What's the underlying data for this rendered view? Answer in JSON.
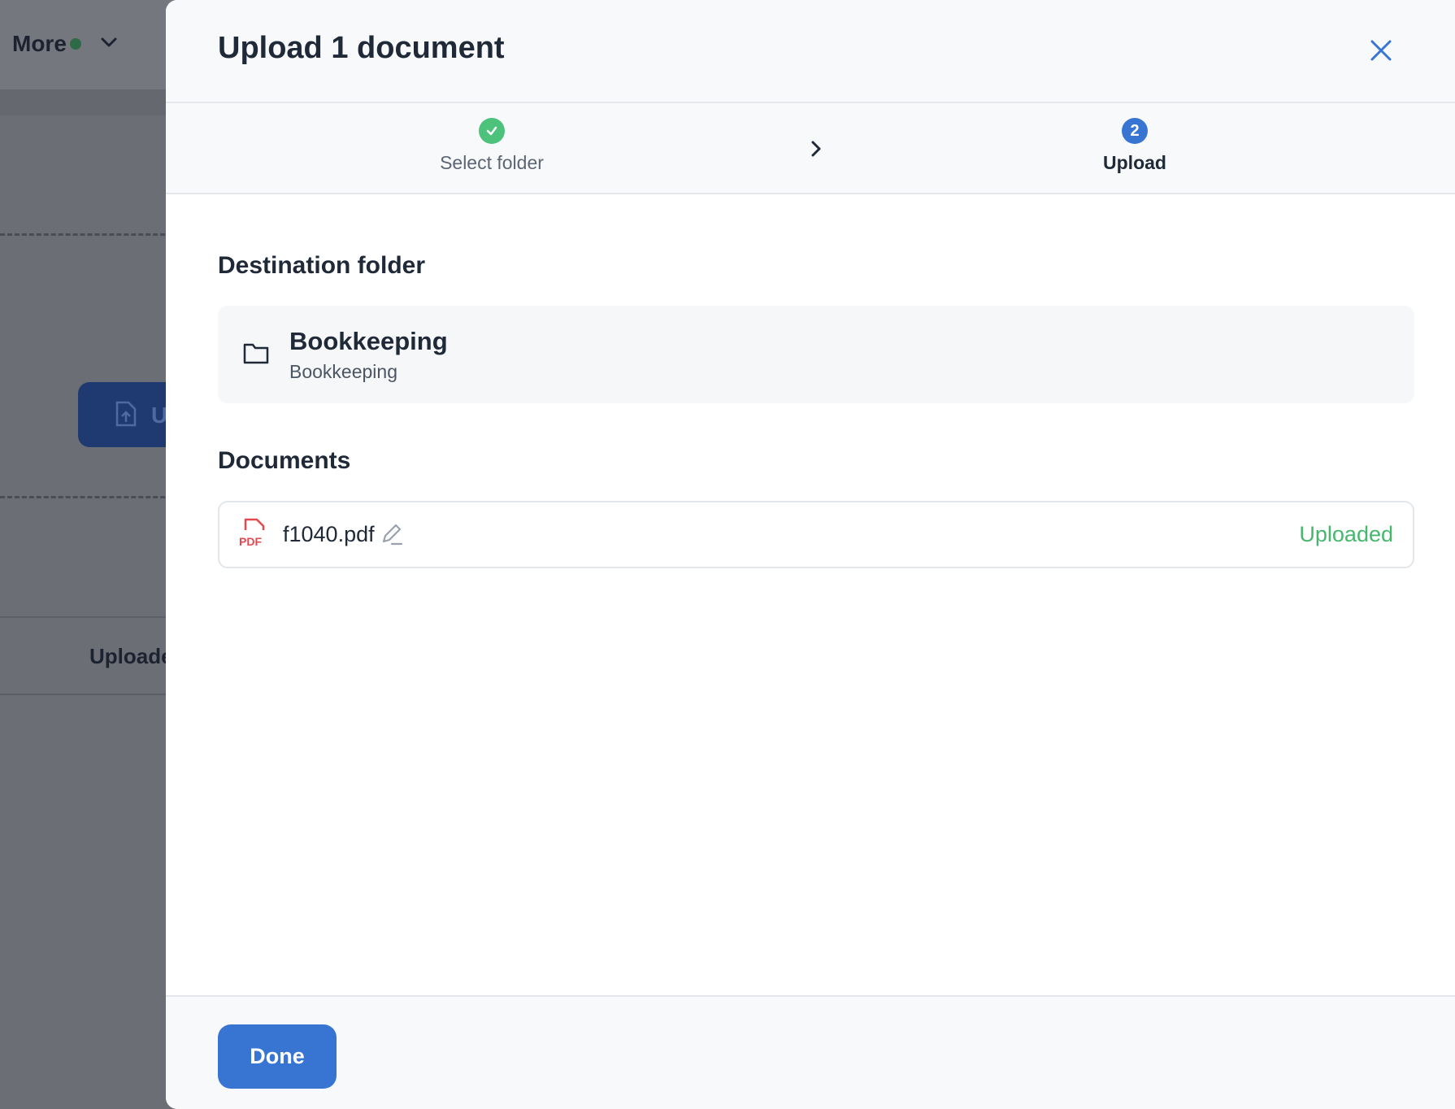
{
  "background": {
    "more_label": "More",
    "upload_button_partial": "U",
    "column_header_partial": "Uploade"
  },
  "modal": {
    "title": "Upload 1 document",
    "steps": [
      {
        "label": "Select folder",
        "state": "done"
      },
      {
        "label": "Upload",
        "number": "2",
        "state": "active"
      }
    ],
    "destination": {
      "section_title": "Destination folder",
      "folder_name": "Bookkeeping",
      "folder_path": "Bookkeeping"
    },
    "documents": {
      "section_title": "Documents",
      "items": [
        {
          "file_name": "f1040.pdf",
          "status": "Uploaded",
          "file_type_label": "PDF"
        }
      ]
    },
    "footer": {
      "done_label": "Done"
    }
  },
  "colors": {
    "accent": "#3875d3",
    "success": "#45b86d",
    "pdf": "#e5484d"
  },
  "icons": [
    "close-icon",
    "check-icon",
    "chevron-right-icon",
    "folder-icon",
    "pdf-icon",
    "edit-pencil-icon"
  ]
}
